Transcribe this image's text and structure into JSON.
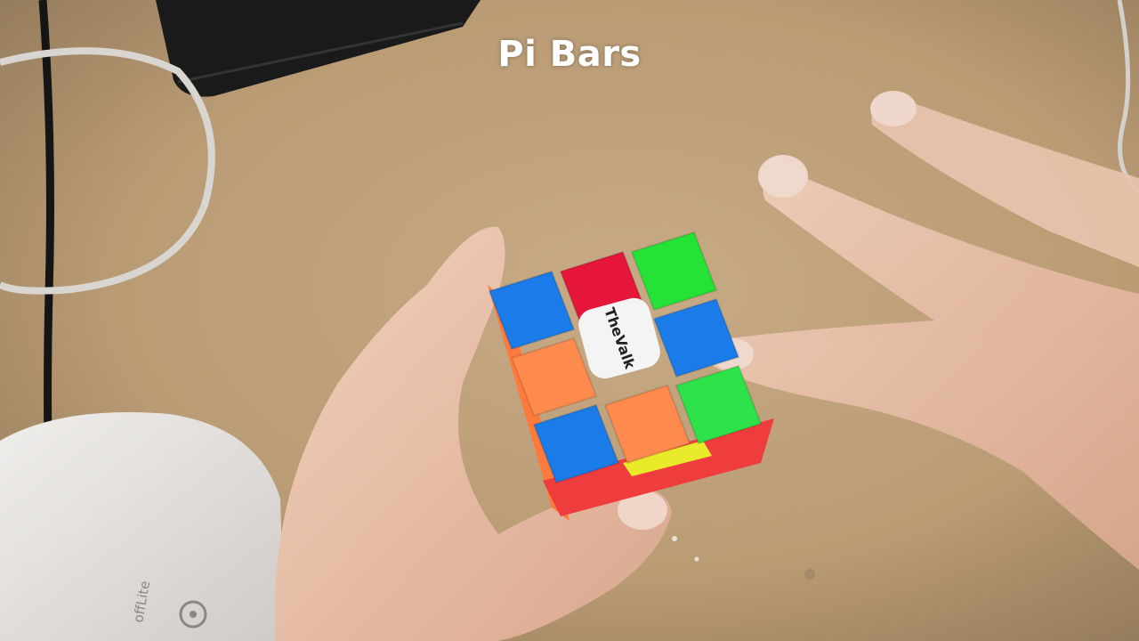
{
  "caption": "Pi Bars",
  "cube": {
    "center_logo": "TheValk",
    "top_face_colors": [
      [
        "#1b7be8",
        "#e5163a",
        "#24e336"
      ],
      [
        "#ff8a4d",
        "#f4f4f4",
        "#1b7be8"
      ],
      [
        "#1b7be8",
        "#ff8a4d",
        "#2ee34a"
      ]
    ]
  },
  "device": {
    "brand_label": "offLite"
  },
  "colors": {
    "desk": "#bfa27c",
    "skin": "#e8c1ab",
    "white_device": "#e6e4e2"
  }
}
